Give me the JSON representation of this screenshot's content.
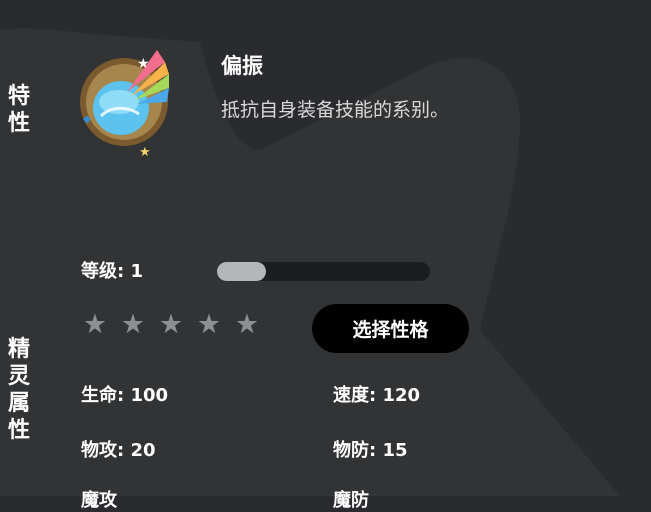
{
  "trait": {
    "side_label": [
      "特",
      "性"
    ],
    "icon": "mirror-rainbow-icon",
    "name": "偏振",
    "description": "抵抗自身装备技能的系别。"
  },
  "level": {
    "label": "等级: 1",
    "progress_fraction": 0.23
  },
  "stars": {
    "total": 5,
    "filled": 0,
    "glyph": "★",
    "color": "#8e8f92"
  },
  "select_button": {
    "label": "选择性格"
  },
  "attributes": {
    "side_label": [
      "精",
      "灵",
      "属",
      "性"
    ],
    "hp": "生命: 100",
    "speed": "速度: 120",
    "atk": "物攻: 20",
    "def": "物防: 15",
    "matk": "魔攻",
    "mdef": "魔防"
  },
  "colors": {
    "background": "#2a2b2e",
    "panel": "#313335",
    "button": "#000000",
    "bar_track": "#1c1d1f",
    "bar_fill": "#b5b6b9"
  }
}
